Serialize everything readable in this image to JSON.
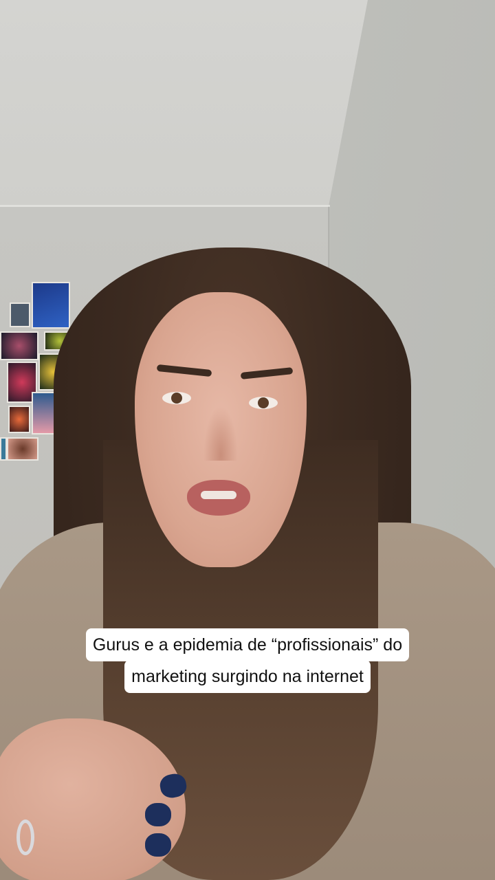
{
  "video": {
    "caption_lines": [
      "Gurus e a epidemia de “profissionais” do",
      "marketing surgindo na internet"
    ]
  },
  "colors": {
    "caption_background": "#ffffff",
    "caption_text": "#111111",
    "nail_polish": "#1d2f5c"
  }
}
